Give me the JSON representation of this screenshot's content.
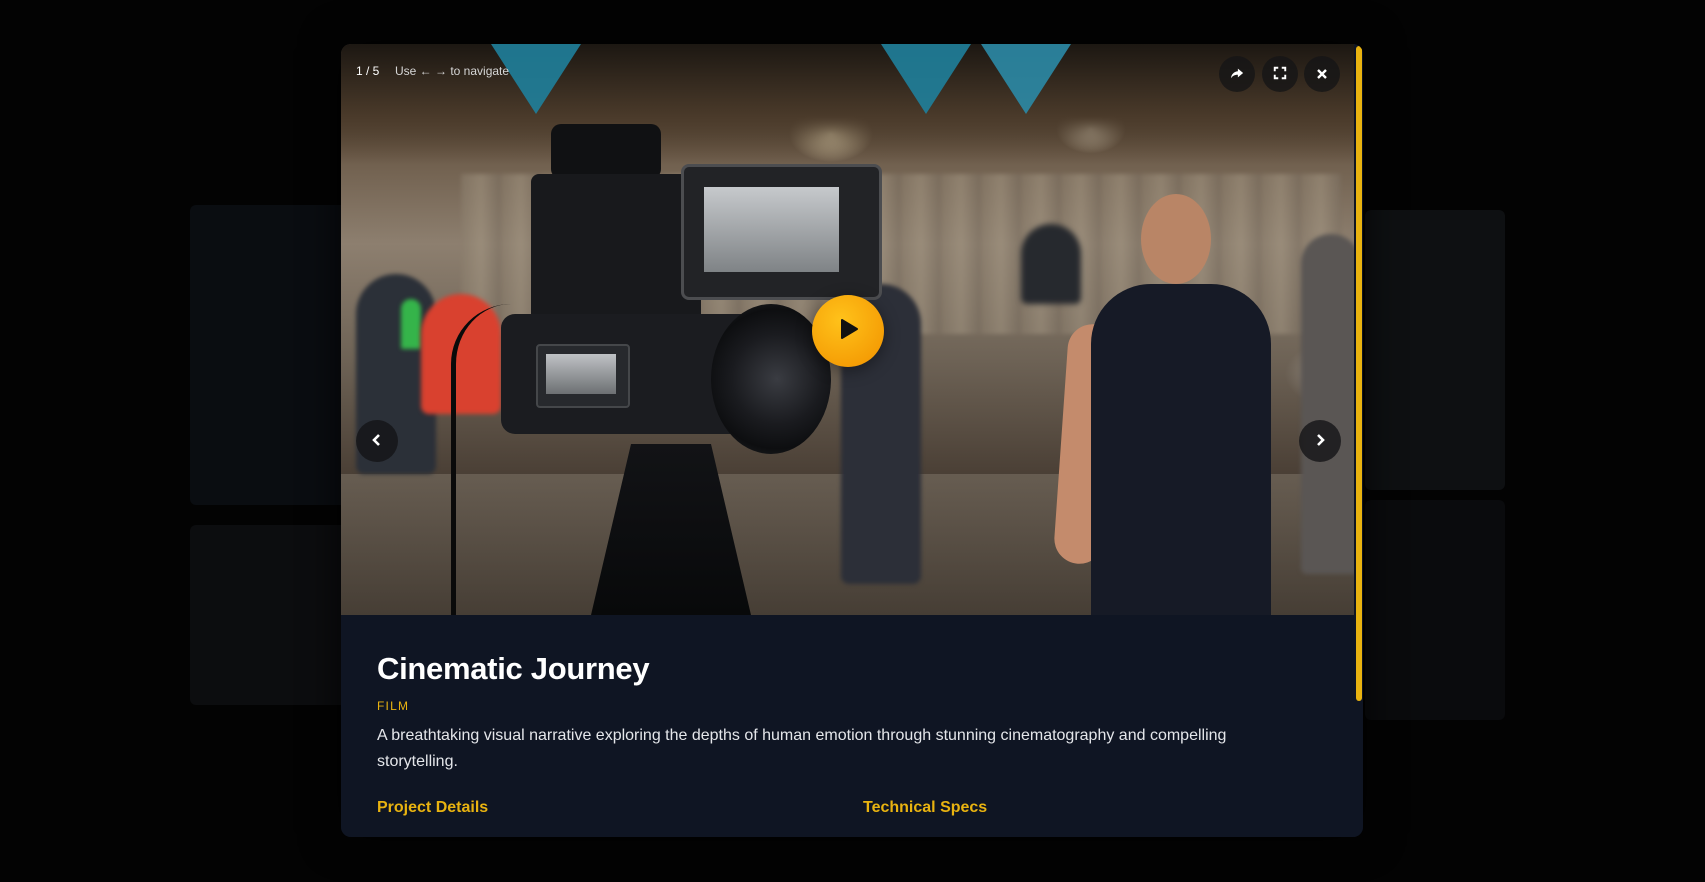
{
  "gallery": {
    "counter": "1 / 5",
    "nav_hint": "Use ← → to navigate"
  },
  "toolbar": {
    "share_icon": "share-icon",
    "fullscreen_icon": "fullscreen-icon",
    "close_icon": "close-icon"
  },
  "navigation": {
    "prev_icon": "chevron-left-icon",
    "next_icon": "chevron-right-icon"
  },
  "player": {
    "play_icon": "play-icon",
    "accent_color": "#f5a20a"
  },
  "project": {
    "title": "Cinematic Journey",
    "category": "FILM",
    "description": "A breathtaking visual narrative exploring the depths of human emotion through stunning cinematography and compelling storytelling."
  },
  "sections": {
    "details_heading": "Project Details",
    "specs_heading": "Technical Specs"
  },
  "colors": {
    "accent": "#e9b310",
    "panel_bg": "#0f1523",
    "backdrop": "#030303"
  }
}
